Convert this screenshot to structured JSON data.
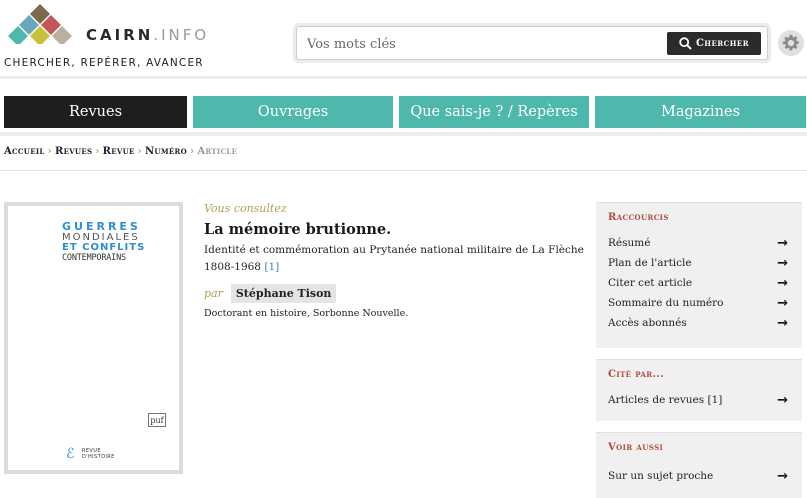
{
  "brand": {
    "name": "CAIRN",
    "suffix": ".INFO",
    "tagline": "CHERCHER, REPÉRER, AVANCER",
    "colors": [
      "#7b6a4a",
      "#c4565a",
      "#69a8b8",
      "#b8b0a0",
      "#c8c23a",
      "#4fb8ac"
    ]
  },
  "search": {
    "placeholder": "Vos mots clés",
    "button_label": "Chercher"
  },
  "settings": {
    "icon": "gear-icon"
  },
  "nav": {
    "tabs": [
      {
        "label": "Revues",
        "active": true
      },
      {
        "label": "Ouvrages",
        "active": false
      },
      {
        "label": "Que sais-je ? / Repères",
        "active": false
      },
      {
        "label": "Magazines",
        "active": false
      }
    ],
    "active_color": "#1e1e1e",
    "tab_color": "#4fb8ac"
  },
  "breadcrumb": {
    "items": [
      "Accueil",
      "Revues",
      "Revue",
      "Numéro"
    ],
    "current": "Article"
  },
  "cover": {
    "line1": "GUERRES",
    "line2": "MONDIALES",
    "line3": "ET CONFLITS",
    "line4": "CONTEMPORAINS",
    "publisher": "puf",
    "imprint_line1": "REVUE",
    "imprint_line2": "D'HISTOIRE"
  },
  "article": {
    "consult_label": "Vous consultez",
    "title": "La mémoire brutionne.",
    "subtitle": "Identité et commémoration au Prytanée national militaire de La Flèche 1808-1968",
    "subtitle_ref": "[1]",
    "by_label": "par",
    "author": "Stéphane Tison",
    "affiliation": "Doctorant en histoire, Sorbonne Nouvelle."
  },
  "sidebar": {
    "shortcuts": {
      "heading": "Raccourcis",
      "items": [
        "Résumé",
        "Plan de l'article",
        "Citer cet article",
        "Sommaire du numéro",
        "Accès abonnés"
      ]
    },
    "cited_by": {
      "heading": "Cité par...",
      "items": [
        "Articles de revues [1]"
      ]
    },
    "see_also": {
      "heading": "Voir aussi",
      "items": [
        "Sur un sujet proche"
      ]
    },
    "heading_color": "#b04a3a"
  }
}
